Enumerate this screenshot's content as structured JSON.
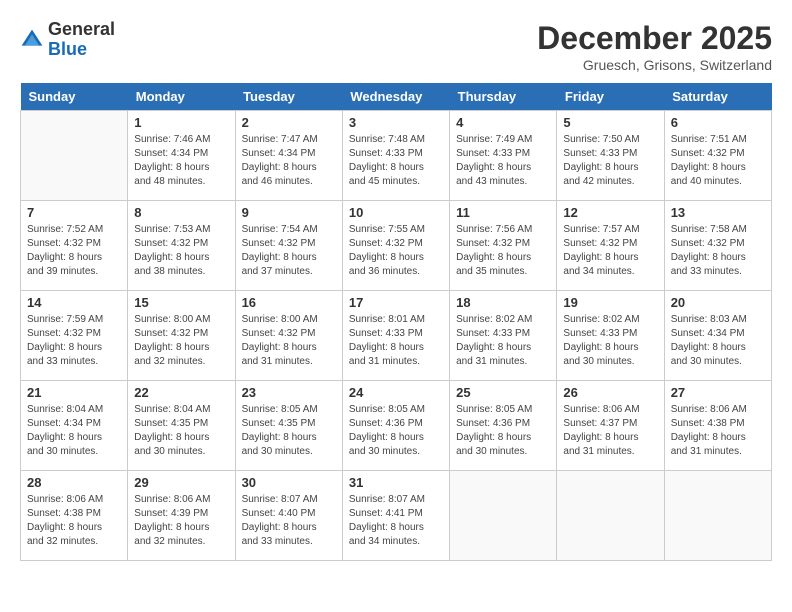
{
  "header": {
    "logo_general": "General",
    "logo_blue": "Blue",
    "month_title": "December 2025",
    "location": "Gruesch, Grisons, Switzerland"
  },
  "days_of_week": [
    "Sunday",
    "Monday",
    "Tuesday",
    "Wednesday",
    "Thursday",
    "Friday",
    "Saturday"
  ],
  "weeks": [
    [
      {
        "day": "",
        "info": ""
      },
      {
        "day": "1",
        "info": "Sunrise: 7:46 AM\nSunset: 4:34 PM\nDaylight: 8 hours\nand 48 minutes."
      },
      {
        "day": "2",
        "info": "Sunrise: 7:47 AM\nSunset: 4:34 PM\nDaylight: 8 hours\nand 46 minutes."
      },
      {
        "day": "3",
        "info": "Sunrise: 7:48 AM\nSunset: 4:33 PM\nDaylight: 8 hours\nand 45 minutes."
      },
      {
        "day": "4",
        "info": "Sunrise: 7:49 AM\nSunset: 4:33 PM\nDaylight: 8 hours\nand 43 minutes."
      },
      {
        "day": "5",
        "info": "Sunrise: 7:50 AM\nSunset: 4:33 PM\nDaylight: 8 hours\nand 42 minutes."
      },
      {
        "day": "6",
        "info": "Sunrise: 7:51 AM\nSunset: 4:32 PM\nDaylight: 8 hours\nand 40 minutes."
      }
    ],
    [
      {
        "day": "7",
        "info": "Sunrise: 7:52 AM\nSunset: 4:32 PM\nDaylight: 8 hours\nand 39 minutes."
      },
      {
        "day": "8",
        "info": "Sunrise: 7:53 AM\nSunset: 4:32 PM\nDaylight: 8 hours\nand 38 minutes."
      },
      {
        "day": "9",
        "info": "Sunrise: 7:54 AM\nSunset: 4:32 PM\nDaylight: 8 hours\nand 37 minutes."
      },
      {
        "day": "10",
        "info": "Sunrise: 7:55 AM\nSunset: 4:32 PM\nDaylight: 8 hours\nand 36 minutes."
      },
      {
        "day": "11",
        "info": "Sunrise: 7:56 AM\nSunset: 4:32 PM\nDaylight: 8 hours\nand 35 minutes."
      },
      {
        "day": "12",
        "info": "Sunrise: 7:57 AM\nSunset: 4:32 PM\nDaylight: 8 hours\nand 34 minutes."
      },
      {
        "day": "13",
        "info": "Sunrise: 7:58 AM\nSunset: 4:32 PM\nDaylight: 8 hours\nand 33 minutes."
      }
    ],
    [
      {
        "day": "14",
        "info": "Sunrise: 7:59 AM\nSunset: 4:32 PM\nDaylight: 8 hours\nand 33 minutes."
      },
      {
        "day": "15",
        "info": "Sunrise: 8:00 AM\nSunset: 4:32 PM\nDaylight: 8 hours\nand 32 minutes."
      },
      {
        "day": "16",
        "info": "Sunrise: 8:00 AM\nSunset: 4:32 PM\nDaylight: 8 hours\nand 31 minutes."
      },
      {
        "day": "17",
        "info": "Sunrise: 8:01 AM\nSunset: 4:33 PM\nDaylight: 8 hours\nand 31 minutes."
      },
      {
        "day": "18",
        "info": "Sunrise: 8:02 AM\nSunset: 4:33 PM\nDaylight: 8 hours\nand 31 minutes."
      },
      {
        "day": "19",
        "info": "Sunrise: 8:02 AM\nSunset: 4:33 PM\nDaylight: 8 hours\nand 30 minutes."
      },
      {
        "day": "20",
        "info": "Sunrise: 8:03 AM\nSunset: 4:34 PM\nDaylight: 8 hours\nand 30 minutes."
      }
    ],
    [
      {
        "day": "21",
        "info": "Sunrise: 8:04 AM\nSunset: 4:34 PM\nDaylight: 8 hours\nand 30 minutes."
      },
      {
        "day": "22",
        "info": "Sunrise: 8:04 AM\nSunset: 4:35 PM\nDaylight: 8 hours\nand 30 minutes."
      },
      {
        "day": "23",
        "info": "Sunrise: 8:05 AM\nSunset: 4:35 PM\nDaylight: 8 hours\nand 30 minutes."
      },
      {
        "day": "24",
        "info": "Sunrise: 8:05 AM\nSunset: 4:36 PM\nDaylight: 8 hours\nand 30 minutes."
      },
      {
        "day": "25",
        "info": "Sunrise: 8:05 AM\nSunset: 4:36 PM\nDaylight: 8 hours\nand 30 minutes."
      },
      {
        "day": "26",
        "info": "Sunrise: 8:06 AM\nSunset: 4:37 PM\nDaylight: 8 hours\nand 31 minutes."
      },
      {
        "day": "27",
        "info": "Sunrise: 8:06 AM\nSunset: 4:38 PM\nDaylight: 8 hours\nand 31 minutes."
      }
    ],
    [
      {
        "day": "28",
        "info": "Sunrise: 8:06 AM\nSunset: 4:38 PM\nDaylight: 8 hours\nand 32 minutes."
      },
      {
        "day": "29",
        "info": "Sunrise: 8:06 AM\nSunset: 4:39 PM\nDaylight: 8 hours\nand 32 minutes."
      },
      {
        "day": "30",
        "info": "Sunrise: 8:07 AM\nSunset: 4:40 PM\nDaylight: 8 hours\nand 33 minutes."
      },
      {
        "day": "31",
        "info": "Sunrise: 8:07 AM\nSunset: 4:41 PM\nDaylight: 8 hours\nand 34 minutes."
      },
      {
        "day": "",
        "info": ""
      },
      {
        "day": "",
        "info": ""
      },
      {
        "day": "",
        "info": ""
      }
    ]
  ]
}
